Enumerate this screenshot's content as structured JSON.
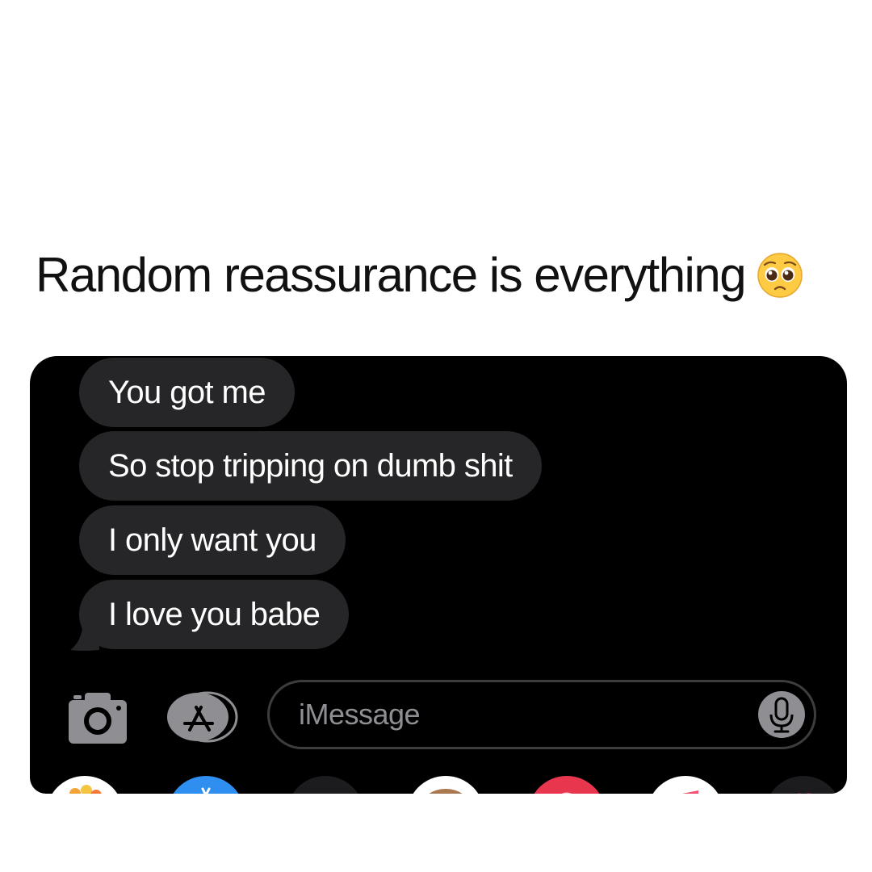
{
  "caption": {
    "text": "Random reassurance is everything",
    "emoji_icon": "pleading-face-emoji"
  },
  "messages": [
    "You got me",
    "So stop tripping on dumb shit",
    "I only want you",
    "I love you babe"
  ],
  "composer": {
    "placeholder": "iMessage",
    "camera_icon": "camera-icon",
    "apps_icon": "app-store-icon",
    "mic_icon": "microphone-icon"
  },
  "app_tray": [
    {
      "icon": "photos-app-icon",
      "color": "#ffffff"
    },
    {
      "icon": "app-store-app-icon",
      "color": "#2f8ff0"
    },
    {
      "icon": "dark-app-icon",
      "color": "#1c1c1e"
    },
    {
      "icon": "memoji-app-icon",
      "color": "#ffffff"
    },
    {
      "icon": "search-images-app-icon",
      "color": "#e8364f"
    },
    {
      "icon": "music-app-icon",
      "color": "#ffffff"
    },
    {
      "icon": "digital-touch-app-icon",
      "color": "#1c1c1e"
    }
  ],
  "colors": {
    "screen_background": "#000000",
    "bubble_gray": "#262628",
    "placeholder_gray": "#8e8e93"
  }
}
